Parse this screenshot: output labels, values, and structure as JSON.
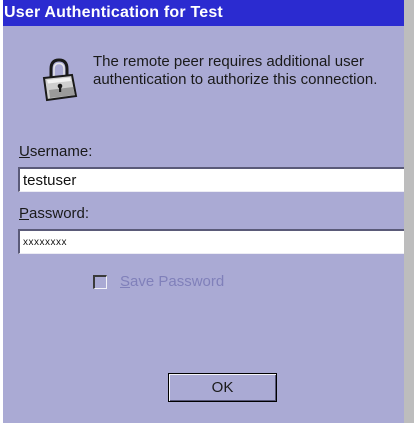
{
  "window": {
    "title": "User Authentication for Test",
    "titlebar_color": "#2b2bd0",
    "body_color": "#aaaad4"
  },
  "message": {
    "icon": "lock-icon",
    "text": "The remote peer requires additional user authentication to authorize this connection."
  },
  "username": {
    "label_accel": "U",
    "label_rest": "sername:",
    "value": "testuser"
  },
  "password": {
    "label_accel": "P",
    "label_rest": "assword:",
    "value": "xxxxxxxx"
  },
  "save_password": {
    "label_accel": "S",
    "label_rest": "ave Password",
    "checked": false,
    "enabled": false
  },
  "buttons": {
    "ok_label": "OK"
  }
}
